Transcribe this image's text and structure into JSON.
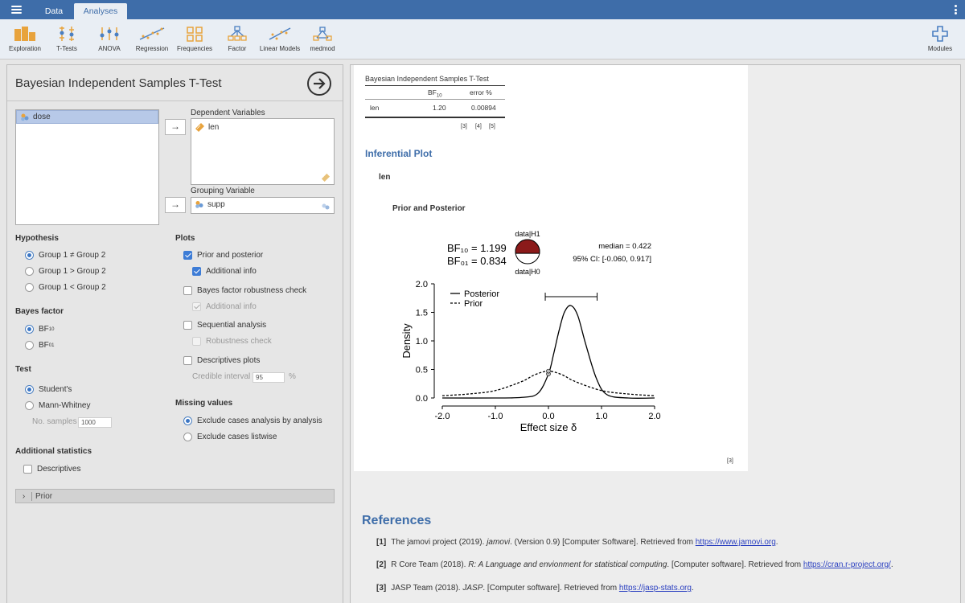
{
  "tabs": {
    "data": "Data",
    "analyses": "Analyses"
  },
  "ribbon": [
    {
      "label": "Exploration",
      "icon": "exploration-icon"
    },
    {
      "label": "T-Tests",
      "icon": "t-tests-icon"
    },
    {
      "label": "ANOVA",
      "icon": "anova-icon"
    },
    {
      "label": "Regression",
      "icon": "regression-icon"
    },
    {
      "label": "Frequencies",
      "icon": "frequencies-icon"
    },
    {
      "label": "Factor",
      "icon": "factor-icon"
    },
    {
      "label": "Linear Models",
      "icon": "linear-models-icon"
    },
    {
      "label": "medmod",
      "icon": "medmod-icon"
    }
  ],
  "modules_label": "Modules",
  "colors": {
    "topbar": "#3e6da9",
    "accent": "#3e6da9",
    "link": "#2a3fc0",
    "pie_fill": "#8b1a1a"
  },
  "options": {
    "title": "Bayesian Independent Samples T-Test",
    "variables": [
      "dose"
    ],
    "dependent_label": "Dependent Variables",
    "dependent_vars": [
      "len"
    ],
    "grouping_label": "Grouping Variable",
    "grouping_var": "supp",
    "arrow": "→",
    "hypothesis": {
      "heading": "Hypothesis",
      "options": [
        "Group 1 ≠ Group 2",
        "Group 1 > Group 2",
        "Group 1 < Group 2"
      ],
      "selected": 0
    },
    "bayes_factor": {
      "heading": "Bayes factor",
      "bf10_main": "BF",
      "bf10_sub": "10",
      "bf01_main": "BF",
      "bf01_sub": "01"
    },
    "test": {
      "heading": "Test",
      "students": "Student's",
      "mann_whitney": "Mann-Whitney",
      "samples_label": "No. samples",
      "samples_value": "1000"
    },
    "additional": {
      "heading": "Additional statistics",
      "descriptives": "Descriptives"
    },
    "plots": {
      "heading": "Plots",
      "prior_posterior": "Prior and posterior",
      "additional_info": "Additional info",
      "robustness": "Bayes factor robustness check",
      "robustness_info": "Additional info",
      "sequential": "Sequential analysis",
      "seq_robustness": "Robustness check",
      "descriptives_plots": "Descriptives plots",
      "credible_label": "Credible interval",
      "credible_value": "95",
      "percent": "%"
    },
    "missing": {
      "heading": "Missing values",
      "opt1": "Exclude cases analysis by analysis",
      "opt2": "Exclude cases listwise"
    },
    "prior_section": "Prior"
  },
  "results": {
    "table": {
      "title": "Bayesian Independent Samples T-Test",
      "col_bf_main": "BF",
      "col_bf_sub": "10",
      "col_error": "error %",
      "row_label": "len",
      "bf": "1.20",
      "error": "0.00894",
      "footnotes": [
        "[3]",
        "[4]",
        "[5]"
      ]
    },
    "inferential_title": "Inferential Plot",
    "var_label": "len",
    "plot_subtitle": "Prior and Posterior",
    "plot_footnote": "[3]"
  },
  "chart_data": {
    "type": "line",
    "xlabel": "Effect size δ",
    "ylabel": "Density",
    "xlim": [
      -2.0,
      2.0
    ],
    "ylim": [
      0.0,
      2.0
    ],
    "x_ticks": [
      "-2.0",
      "-1.0",
      "0.0",
      "1.0",
      "2.0"
    ],
    "y_ticks": [
      "0.0",
      "0.5",
      "1.0",
      "1.5",
      "2.0"
    ],
    "series": [
      {
        "name": "Posterior",
        "style": "solid",
        "x": [
          -2.0,
          -1.0,
          -0.5,
          -0.2,
          0.0,
          0.1,
          0.2,
          0.3,
          0.42,
          0.55,
          0.7,
          0.9,
          1.1,
          1.5,
          2.0
        ],
        "y": [
          0.0,
          0.0,
          0.01,
          0.08,
          0.42,
          0.78,
          1.18,
          1.5,
          1.62,
          1.45,
          0.95,
          0.35,
          0.06,
          0.0,
          0.0
        ]
      },
      {
        "name": "Prior",
        "style": "dashed",
        "x": [
          -2.0,
          -1.5,
          -1.0,
          -0.5,
          -0.25,
          0.0,
          0.25,
          0.5,
          1.0,
          1.5,
          2.0
        ],
        "y": [
          0.04,
          0.07,
          0.13,
          0.29,
          0.41,
          0.47,
          0.41,
          0.29,
          0.13,
          0.07,
          0.04
        ]
      }
    ],
    "bf10_label": "BF₁₀ = 1.199",
    "bf01_label": "BF₀₁ = 0.834",
    "pie_top": "data|H1",
    "pie_bottom": "data|H0",
    "pie_h1_fraction": 0.545,
    "median": "median = 0.422",
    "ci": "95% CI: [-0.060, 0.917]",
    "ci_range": [
      -0.06,
      0.917
    ]
  },
  "references": {
    "title": "References",
    "items": [
      {
        "num": "[1]",
        "text": "The jamovi project (2019). ",
        "italic": "jamovi",
        "rest": ". (Version 0.9) [Computer Software]. Retrieved from ",
        "link": "https://www.jamovi.org",
        "end": "."
      },
      {
        "num": "[2]",
        "text": "R Core Team (2018). ",
        "italic": "R: A Language and envionment for statistical computing",
        "rest": ". [Computer software]. Retrieved from ",
        "link": "https://cran.r-project.org/",
        "end": "."
      },
      {
        "num": "[3]",
        "text": "JASP Team (2018). ",
        "italic": "JASP",
        "rest": ". [Computer software]. Retrieved from ",
        "link": "https://jasp-stats.org",
        "end": "."
      }
    ]
  }
}
